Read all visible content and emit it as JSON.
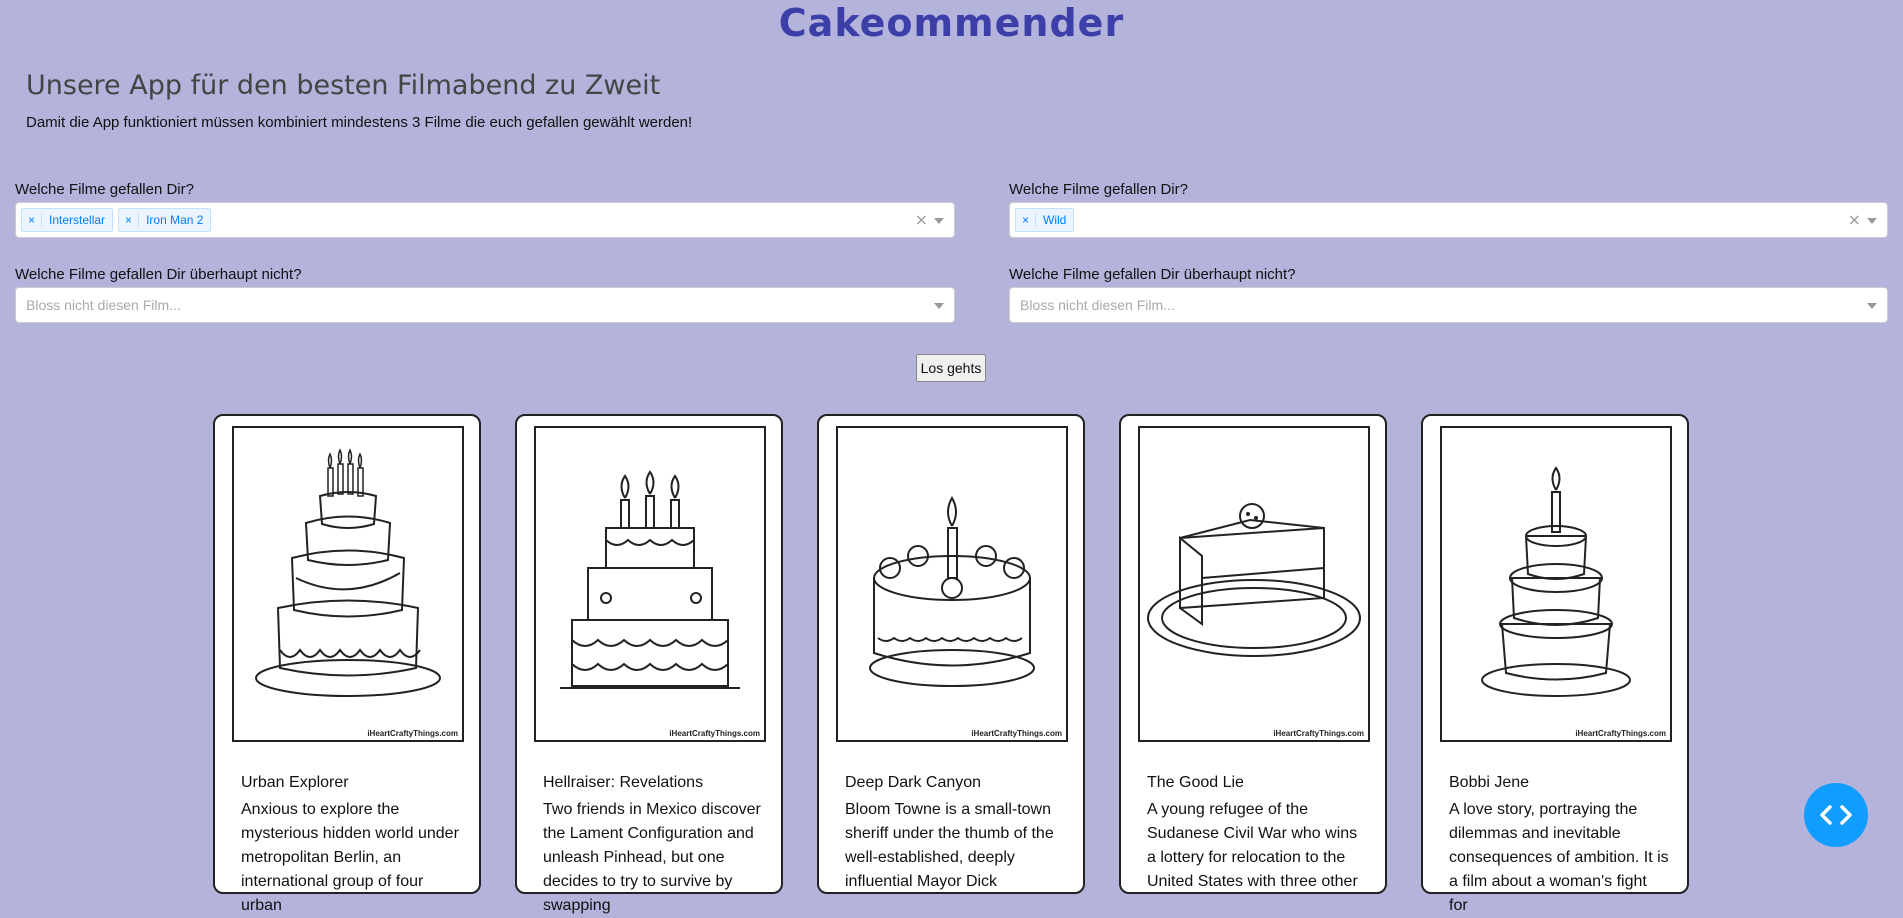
{
  "app_title": "Cakeommender",
  "subtitle": "Unsere App für den besten Filmabend zu Zweit",
  "hint": "Damit die App funktioniert müssen kombiniert mindestens 3 Filme die euch gefallen gewählt werden!",
  "left": {
    "likes_label": "Welche Filme gefallen Dir?",
    "likes_selected": [
      "Interstellar",
      "Iron Man 2"
    ],
    "dislikes_label": "Welche Filme gefallen Dir überhaupt nicht?",
    "dislikes_placeholder": "Bloss nicht diesen Film..."
  },
  "right": {
    "likes_label": "Welche Filme gefallen Dir?",
    "likes_selected": [
      "Wild"
    ],
    "dislikes_label": "Welche Filme gefallen Dir überhaupt nicht?",
    "dislikes_placeholder": "Bloss nicht diesen Film..."
  },
  "chip_remove": "×",
  "clear_all": "×",
  "go_button": "Los gehts",
  "image_credit": "iHeartCraftyThings.com",
  "cards": [
    {
      "title": "Urban Explorer",
      "description": "Anxious to explore the mysterious hidden world under metropolitan Berlin, an international group of four urban"
    },
    {
      "title": "Hellraiser: Revelations",
      "description": "Two friends in Mexico discover the Lament Configuration and unleash Pinhead, but one decides to try to survive by swapping"
    },
    {
      "title": "Deep Dark Canyon",
      "description": "Bloom Towne is a small-town sheriff under the thumb of the well-established, deeply influential Mayor Dick"
    },
    {
      "title": "The Good Lie",
      "description": "A young refugee of the Sudanese Civil War who wins a lottery for relocation to the United States with three other"
    },
    {
      "title": "Bobbi Jene",
      "description": "A love story, portraying the dilemmas and inevitable consequences of ambition. It is a film about a woman's fight for"
    }
  ],
  "fab_icon": "code-brackets-icon",
  "colors": {
    "background": "#b3b3dc",
    "title": "#3d3fa8",
    "accent": "#119dff",
    "chip": "#007eff"
  }
}
